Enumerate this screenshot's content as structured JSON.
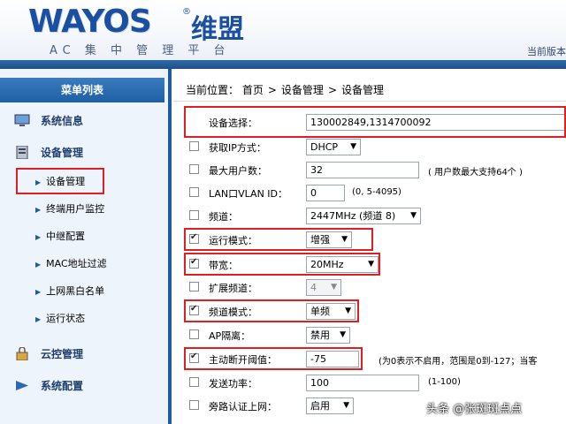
{
  "header": {
    "logo": "WAYOS",
    "logo_cn": "维盟",
    "reg": "®",
    "subtitle": "AC 集 中 管 理 平 台",
    "version": "当前版本"
  },
  "sidebar": {
    "title": "菜单列表",
    "groups": [
      {
        "label": "系统信息",
        "icon": "monitor-icon"
      },
      {
        "label": "设备管理",
        "icon": "server-icon"
      },
      {
        "label": "云控管理",
        "icon": "lock-icon"
      },
      {
        "label": "系统配置",
        "icon": "gear-icon"
      }
    ],
    "items": [
      {
        "label": "设备管理"
      },
      {
        "label": "终端用户监控"
      },
      {
        "label": "中继配置"
      },
      {
        "label": "MAC地址过滤"
      },
      {
        "label": "上网黑白名单"
      },
      {
        "label": "运行状态"
      }
    ]
  },
  "breadcrumb": {
    "prefix": "当前位置：",
    "items": [
      "首页",
      "设备管理",
      "设备管理"
    ],
    "sep": ">"
  },
  "form": {
    "device_label": "设备选择：",
    "device_value": "130002849,1314700092",
    "rows": [
      {
        "label": "获取IP方式：",
        "value": "DHCP",
        "checked": false
      },
      {
        "label": "最大用户数：",
        "value": "32",
        "hint": "( 用户数最大支持64个 )",
        "checked": false
      },
      {
        "label": "LAN口VLAN ID：",
        "value": "0",
        "hint": "(0, 5-4095)",
        "checked": false
      },
      {
        "label": "频道：",
        "value": "2447MHz (频道 8)",
        "checked": false
      },
      {
        "label": "运行模式：",
        "value": "增强",
        "checked": true
      },
      {
        "label": "带宽：",
        "value": "20MHz",
        "checked": true
      },
      {
        "label": "扩展频道：",
        "value": "4",
        "checked": false
      },
      {
        "label": "频道模式：",
        "value": "单频",
        "checked": true
      },
      {
        "label": "AP隔离：",
        "value": "禁用",
        "checked": false
      },
      {
        "label": "主动断开阈值：",
        "value": "-75",
        "hint": "(为0表示不启用，范围是0到-127；当客",
        "checked": true
      },
      {
        "label": "发送功率：",
        "value": "100",
        "hint": "(1-100)",
        "checked": false
      },
      {
        "label": "旁路认证上网：",
        "value": "启用",
        "checked": false
      }
    ]
  },
  "watermark": "头条 @张斑斑点点",
  "colors": {
    "accent": "#1e5b9f",
    "highlight": "#e02020"
  }
}
